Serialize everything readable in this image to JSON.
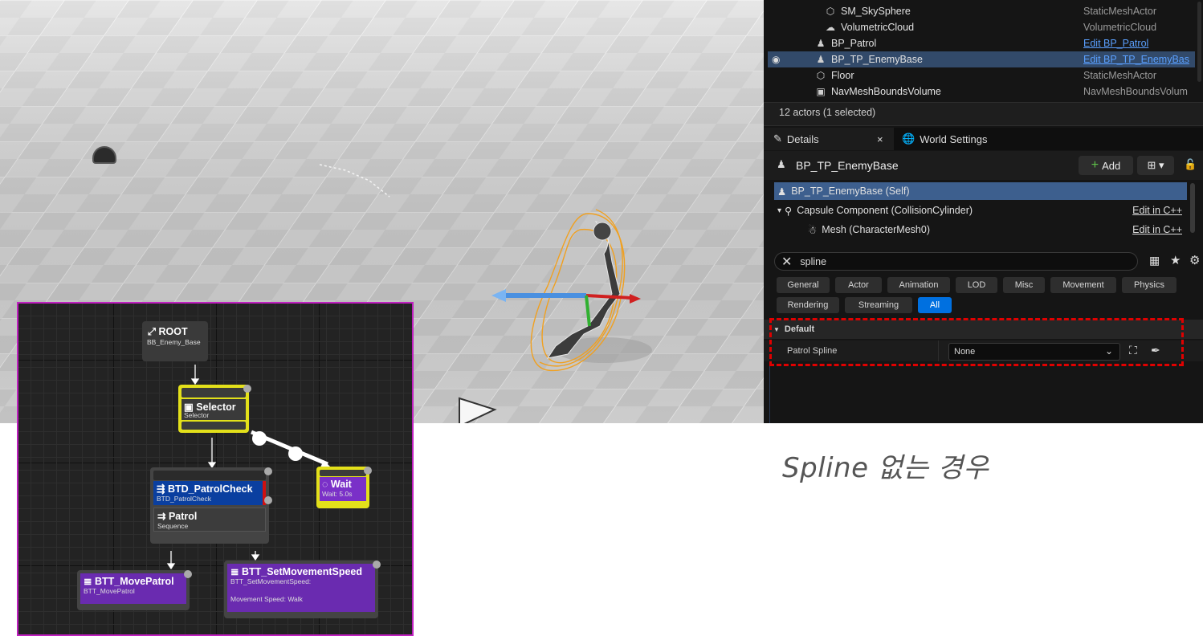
{
  "outliner": {
    "rows": [
      {
        "icon": "static-mesh-icon",
        "name": "SM_SkySphere",
        "type": "StaticMeshActor",
        "link": false
      },
      {
        "icon": "cloud-icon",
        "name": "VolumetricCloud",
        "type": "VolumetricCloud",
        "link": false
      },
      {
        "icon": "pawn-icon",
        "name": "BP_Patrol",
        "type": "Edit BP_Patrol",
        "link": true
      },
      {
        "icon": "pawn-icon",
        "name": "BP_TP_EnemyBase",
        "type": "Edit BP_TP_EnemyBas",
        "link": true,
        "selected": true
      },
      {
        "icon": "static-mesh-icon",
        "name": "Floor",
        "type": "StaticMeshActor",
        "link": false
      },
      {
        "icon": "navmesh-icon",
        "name": "NavMeshBoundsVolume",
        "type": "NavMeshBoundsVolum",
        "link": false
      }
    ],
    "actor_count": "12 actors (1 selected)"
  },
  "tabs": {
    "details": "Details",
    "close": "×",
    "world_settings": "World Settings"
  },
  "details": {
    "actor_name": "BP_TP_EnemyBase",
    "add_label": "Add",
    "components": [
      {
        "name": "BP_TP_EnemyBase (Self)",
        "edit": ""
      },
      {
        "name": "Capsule Component (CollisionCylinder)",
        "edit": "Edit in C++"
      },
      {
        "name": "Mesh (CharacterMesh0)",
        "edit": "Edit in C++"
      }
    ],
    "search_value": "spline",
    "filters_row1": [
      "General",
      "Actor",
      "Animation",
      "LOD",
      "Misc",
      "Movement",
      "Physics"
    ],
    "filters_row2": [
      "Rendering",
      "Streaming",
      "All"
    ],
    "section": "Default",
    "property_name": "Patrol Spline",
    "property_value": "None"
  },
  "behavior_tree": {
    "root": {
      "title": "ROOT",
      "sub": "BB_Enemy_Base"
    },
    "selector": {
      "title": "Selector",
      "sub": "Selector"
    },
    "wait": {
      "title": "Wait",
      "sub": "Wait: 5.0s"
    },
    "patrol_check": {
      "title": "BTD_PatrolCheck",
      "sub": "BTD_PatrolCheck"
    },
    "patrol": {
      "title": "Patrol",
      "sub": "Sequence"
    },
    "move_patrol": {
      "title": "BTT_MovePatrol",
      "sub": "BTT_MovePatrol"
    },
    "set_speed": {
      "title": "BTT_SetMovementSpeed",
      "sub": "BTT_SetMovementSpeed:",
      "sub2": "Movement Speed: Walk"
    }
  },
  "caption": "Spline 없는 경우",
  "colors": {
    "selection": "#324a6a",
    "link": "#5aa0ff",
    "dash": "#e00000",
    "bt_border": "#c020c0",
    "decorator_blue": "#0a3fa0",
    "task_purple": "#6a2bb0",
    "yellow": "#e3e01a",
    "filter_on": "#0070e0"
  }
}
